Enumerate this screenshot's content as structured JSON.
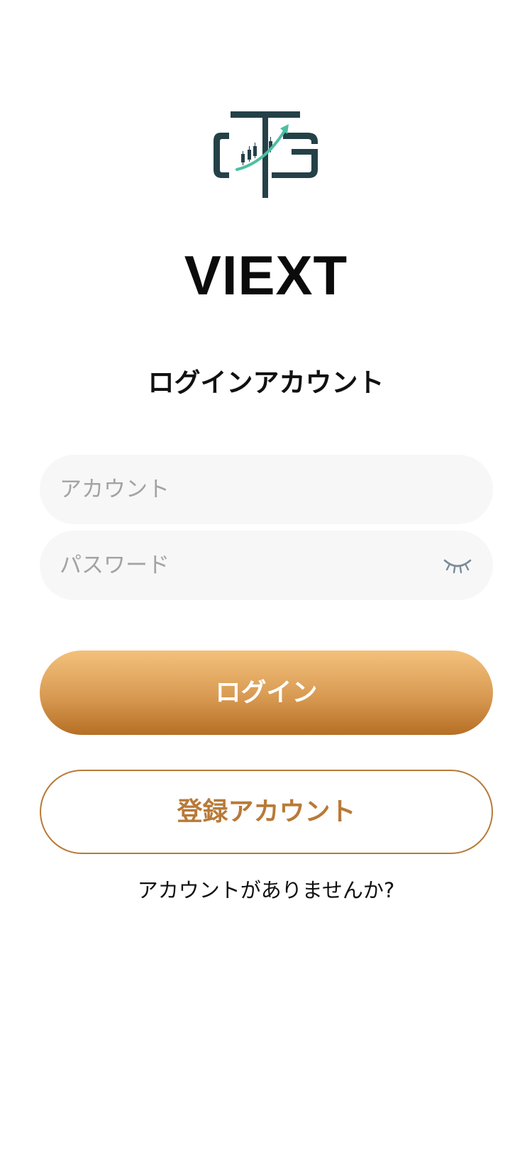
{
  "app": {
    "name": "VIEXT",
    "logo_icon": "ctg-candlestick-arrow-logo"
  },
  "login": {
    "title": "ログインアカウント",
    "account_placeholder": "アカウント",
    "account_value": "",
    "password_placeholder": "パスワード",
    "password_value": "",
    "password_toggle_icon": "eye-closed-icon",
    "login_label": "ログイン",
    "register_label": "登録アカウント",
    "no_account_text": "アカウントがありませんか?"
  },
  "colors": {
    "accent": "#c98a44",
    "accent_light": "#f3c17c",
    "accent_dark": "#b66f24",
    "field_bg": "#f7f7f7",
    "logo_dark": "#244147",
    "logo_teal": "#4dbfa3"
  }
}
